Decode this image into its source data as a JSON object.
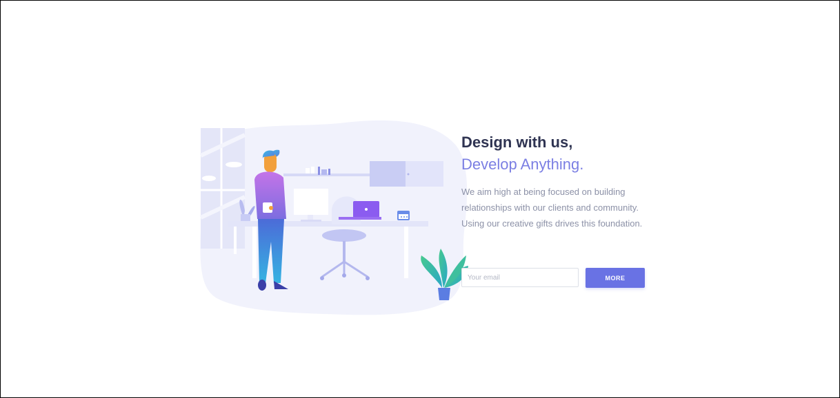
{
  "hero": {
    "title": "Design with us,",
    "subtitle": "Develop Anything.",
    "description": "We aim high at being focused on building relationships with our clients and community. Using our creative gifts drives this foundation."
  },
  "signup": {
    "email_placeholder": "Your email",
    "button_label": "MORE"
  },
  "illustration": {
    "icon": "person-at-desk-illustration"
  },
  "colors": {
    "title": "#2f3452",
    "accent": "#7b7fe3",
    "text_muted": "#8c91a7",
    "button": "#6972e4",
    "blob": "#f1f2fc"
  }
}
